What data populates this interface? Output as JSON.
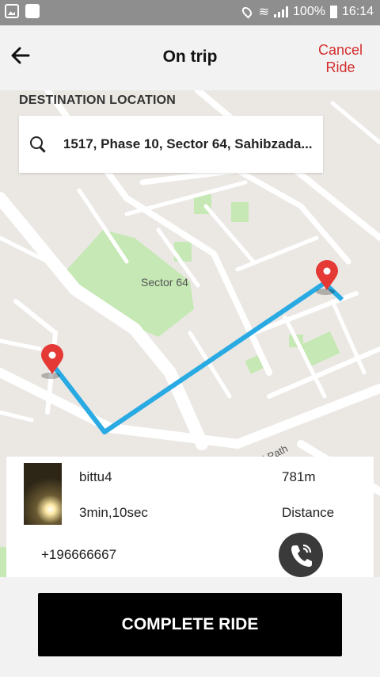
{
  "status_bar": {
    "battery": "100%",
    "time": "16:14"
  },
  "header": {
    "title": "On trip",
    "cancel_line1": "Cancel",
    "cancel_line2": "Ride"
  },
  "destination": {
    "label": "DESTINATION LOCATION",
    "address": "1517, Phase 10, Sector 64, Sahibzada..."
  },
  "map": {
    "area_label": "Sector 64",
    "road_label": "di Path",
    "route_color": "#29aae2",
    "marker_color": "#e53935"
  },
  "trip_info": {
    "rider_name": "bittu4",
    "eta": "3min,10sec",
    "distance_value": "781m",
    "distance_label": "Distance",
    "phone": "+196666667"
  },
  "actions": {
    "complete_label": "COMPLETE RIDE"
  }
}
